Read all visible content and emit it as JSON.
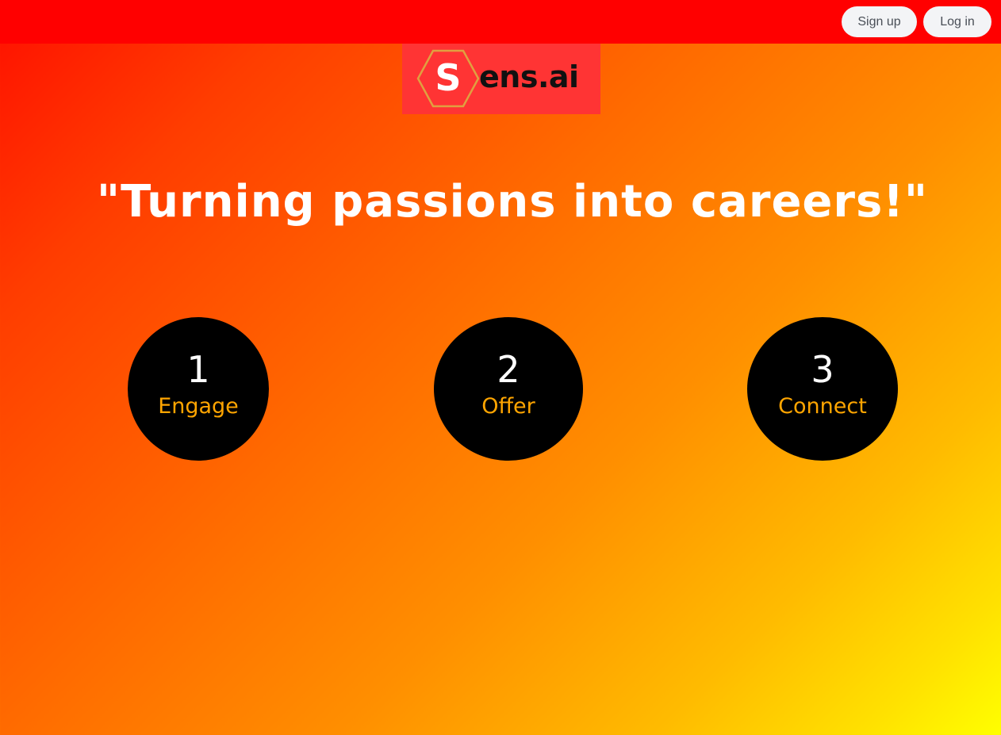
{
  "header": {
    "signup_label": "Sign up",
    "login_label": "Log in"
  },
  "logo": {
    "letter": "S",
    "text": "ens.ai"
  },
  "hero": {
    "tagline": "\"Turning passions into careers!\""
  },
  "steps": [
    {
      "number": "1",
      "label": "Engage"
    },
    {
      "number": "2",
      "label": "Offer"
    },
    {
      "number": "3",
      "label": "Connect"
    }
  ],
  "colors": {
    "topbar": "#ff0000",
    "logo_bg": "#ff3434",
    "step_circle": "#000000",
    "step_label": "#ffa500",
    "hexagon_outline": "#e0a040"
  }
}
